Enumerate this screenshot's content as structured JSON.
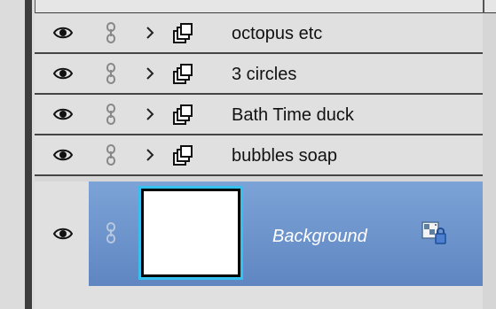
{
  "layers_panel": {
    "group_rows": [
      {
        "label": "octopus etc"
      },
      {
        "label": "3 circles"
      },
      {
        "label": "Bath Time duck"
      },
      {
        "label": "bubbles soap"
      }
    ],
    "background_row": {
      "label": "Background",
      "selected": true
    },
    "icons": {
      "visibility": "eye-icon",
      "link": "link-icon",
      "expand": "chevron-right-icon",
      "group": "layer-group-icon",
      "locked_background": "locked-background-icon"
    },
    "colors": {
      "panel": "#e0e0e0",
      "selection": "#6f97cf",
      "thumbnail_outline": "#35c1ef",
      "row_divider": "#454545"
    }
  }
}
